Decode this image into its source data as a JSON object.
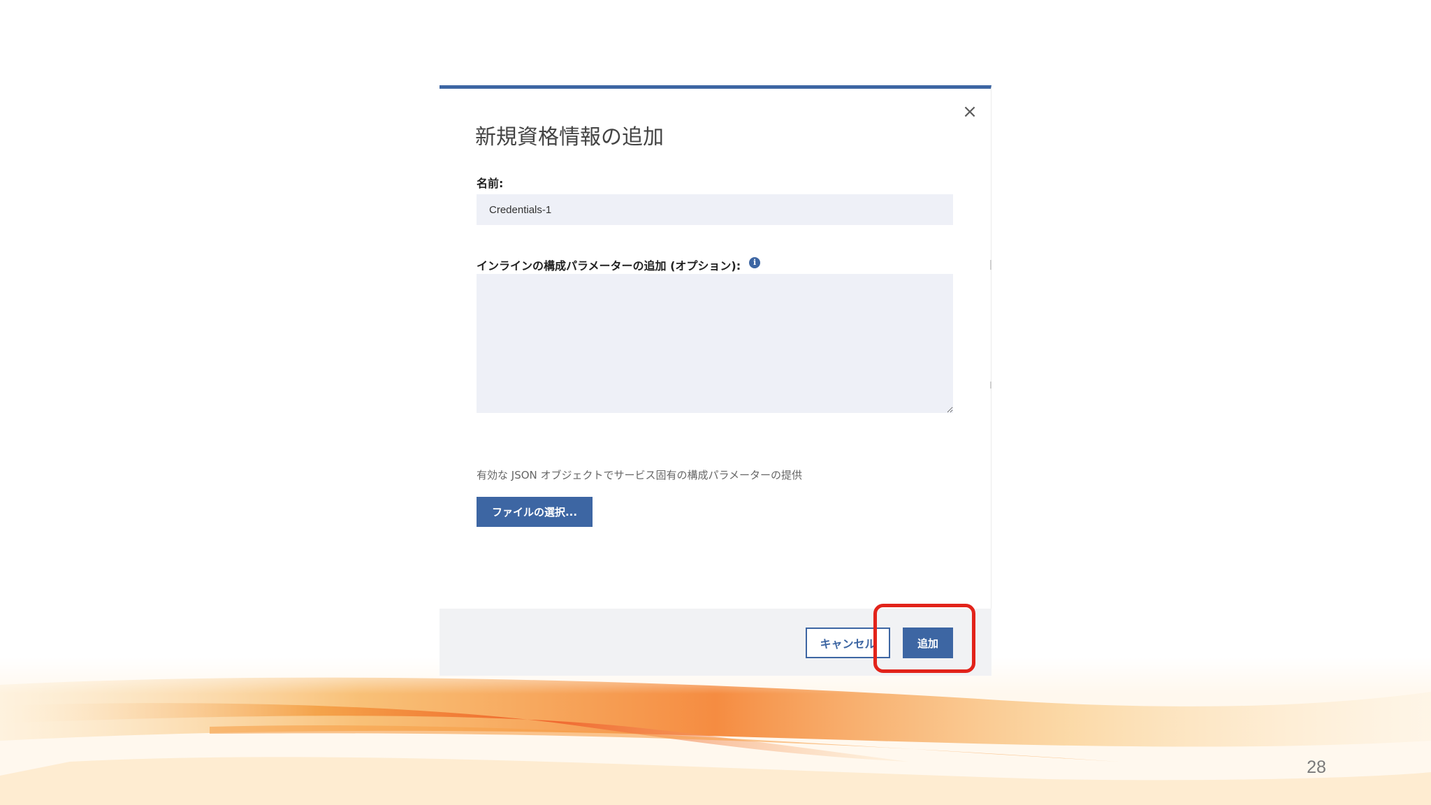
{
  "slide": {
    "page_number": "28"
  },
  "dialog": {
    "title": "新規資格情報の追加",
    "close_icon": "×",
    "name_label": "名前:",
    "name_value": "Credentials-1",
    "params_label": "インラインの構成パラメーターの追加 (オプション):",
    "info_icon": "i",
    "params_value": "",
    "helper_text": "有効な JSON オブジェクトでサービス固有の構成パラメーターの提供",
    "file_button_label": "ファイルの選択...",
    "cancel_label": "キャンセル",
    "add_label": "追加"
  },
  "colors": {
    "accent": "#3d66a3",
    "highlight": "#e2231a",
    "input_bg": "#eef0f7",
    "footer_bg": "#f1f2f4"
  }
}
